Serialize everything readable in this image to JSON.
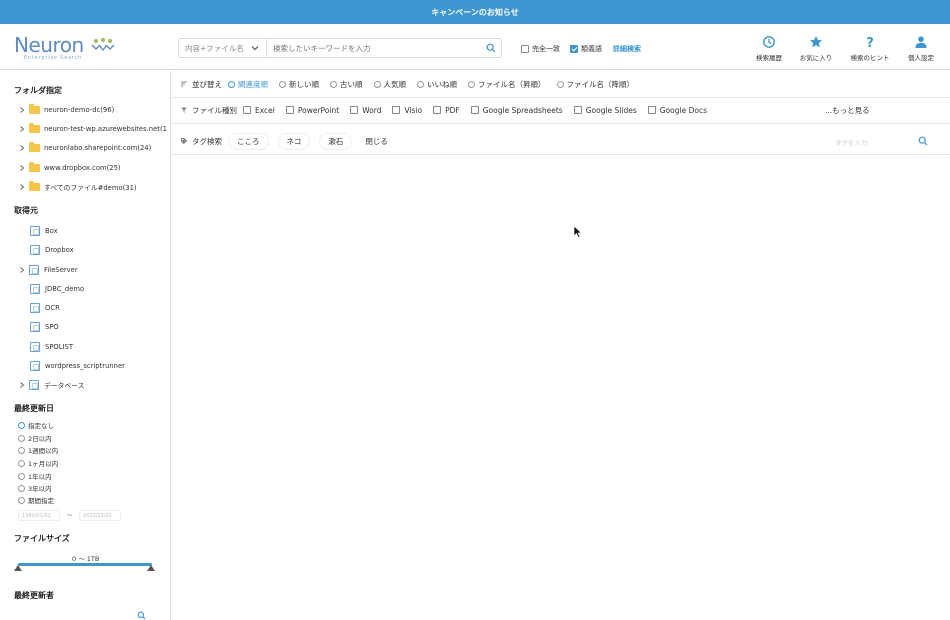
{
  "banner": {
    "text": "キャンペーンのお知らせ"
  },
  "logo": {
    "name": "Neuron",
    "subtitle": "Enterprise Search"
  },
  "search": {
    "scope": "内容+ファイル名",
    "placeholder": "検索したいキーワードを入力",
    "exact_match": "完全一致",
    "synonyms": "類義語",
    "advanced": "詳細検索"
  },
  "header_icons": [
    {
      "label": "検索履歴",
      "icon": "clock-icon"
    },
    {
      "label": "お気に入り",
      "icon": "star-icon"
    },
    {
      "label": "検索のヒント",
      "icon": "question-icon"
    },
    {
      "label": "個人設定",
      "icon": "user-icon"
    }
  ],
  "sidebar": {
    "folder_title": "フォルダ指定",
    "folders": [
      "neuron-demo-dc(96)",
      "neuron-test-wp.azurewebsites.net(1",
      "neuronlabo.sharepoint.com(24)",
      "www.dropbox.com(25)",
      "すべてのファイル#demo(31)"
    ],
    "source_title": "取得元",
    "sources": [
      "Box",
      "Dropbox",
      "FileServer",
      "JDBC_demo",
      "OCR",
      "SPO",
      "SPOLIST",
      "wordpress_scriptrunner",
      "データベース"
    ],
    "updated_title": "最終更新日",
    "updated_options": [
      "指定なし",
      "2日以内",
      "1週間以内",
      "1ヶ月以内",
      "1年以内",
      "3年以内",
      "期間指定"
    ],
    "date_from": "1980/01/01",
    "date_sep": "〜",
    "date_to": "2023/11/01",
    "filesize_title": "ファイルサイズ",
    "filesize_range": "0 〜 1TB",
    "updater_title": "最終更新者"
  },
  "sort": {
    "label": "並び替え",
    "options": [
      "関連度順",
      "新しい順",
      "古い順",
      "人気順",
      "いいね順",
      "ファイル名（昇順）",
      "ファイル名（降順）"
    ],
    "selected": "関連度順"
  },
  "filetype": {
    "label": "ファイル種別",
    "options": [
      "Excel",
      "PowerPoint",
      "Word",
      "Visio",
      "PDF",
      "Google Spreadsheets",
      "Google Slides",
      "Google Docs"
    ],
    "more": "...もっと見る"
  },
  "tags": {
    "label": "タグ検索",
    "chips": [
      "こころ",
      "ネコ",
      "漱石"
    ],
    "close": "閉じる",
    "placeholder": "タグを入力"
  },
  "colors": {
    "accent": "#3d96cf",
    "folder": "#f4c64a"
  }
}
